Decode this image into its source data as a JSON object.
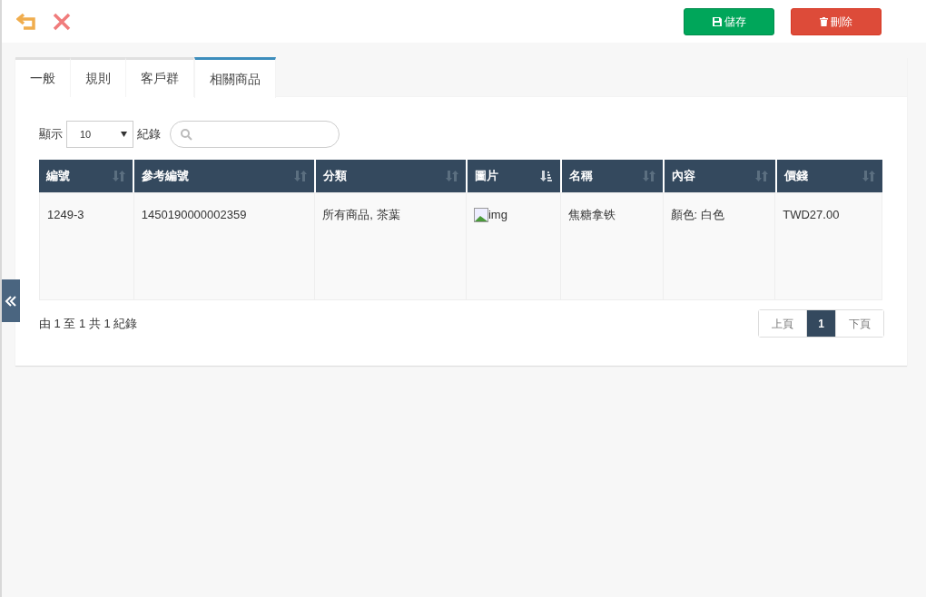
{
  "toolbar": {
    "save_label": "儲存",
    "delete_label": "刪除"
  },
  "tabs": [
    {
      "label": "一般",
      "selected": false
    },
    {
      "label": "規則",
      "selected": false
    },
    {
      "label": "客戶群",
      "selected": false
    },
    {
      "label": "相關商品",
      "selected": true
    }
  ],
  "length_menu": {
    "before": "顯示",
    "value": "10",
    "after": "紀錄"
  },
  "table": {
    "columns": [
      {
        "label": "編號",
        "sorted": false
      },
      {
        "label": "參考編號",
        "sorted": false
      },
      {
        "label": "分類",
        "sorted": false
      },
      {
        "label": "圖片",
        "sorted": true
      },
      {
        "label": "名稱",
        "sorted": false
      },
      {
        "label": "內容",
        "sorted": false
      },
      {
        "label": "價錢",
        "sorted": false
      }
    ],
    "rows": [
      {
        "cells": [
          {
            "kind": "text",
            "text": "1249-3"
          },
          {
            "kind": "text",
            "text": "1450190000002359"
          },
          {
            "kind": "text",
            "text": "所有商品, 茶葉"
          },
          {
            "kind": "image",
            "text": "img"
          },
          {
            "kind": "text",
            "text": "焦糖拿铁"
          },
          {
            "kind": "text",
            "text": "顏色: 白色"
          },
          {
            "kind": "text",
            "text": "TWD27.00"
          }
        ]
      }
    ]
  },
  "info": "由 1 至 1 共 1 紀錄",
  "pagination": [
    {
      "label": "上頁",
      "selected": false,
      "disabled": true
    },
    {
      "label": "1",
      "selected": true,
      "disabled": false
    },
    {
      "label": "下頁",
      "selected": false,
      "disabled": true
    }
  ]
}
